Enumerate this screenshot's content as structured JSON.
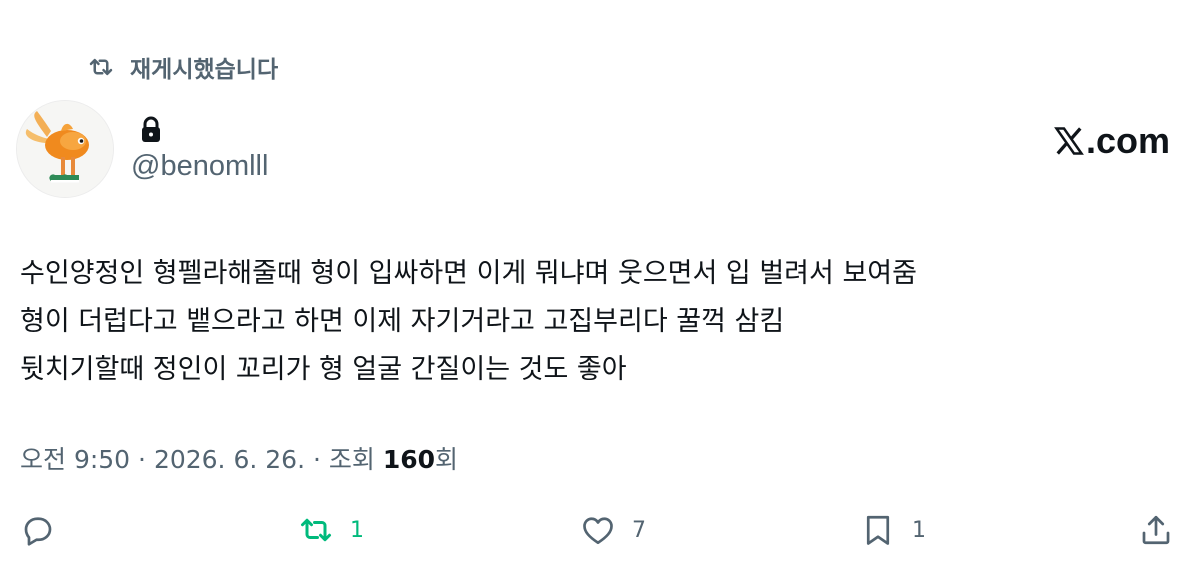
{
  "repost_banner": {
    "label": "재게시했습니다",
    "icon": "repost-icon"
  },
  "author": {
    "display_name_icon": "lock-icon",
    "handle": "@benomlll",
    "avatar": "goldfish-with-sneakers"
  },
  "brand": {
    "label": ".com",
    "icon": "x-logo-icon"
  },
  "tweet": {
    "lines": [
      "수인양정인 형펠라해줄때 형이 입싸하면 이게 뭐냐며 웃으면서 입 벌려서 보여줌",
      "형이 더럽다고 뱉으라고 하면 이제 자기거라고 고집부리다 꿀꺽 삼킴",
      "뒷치기할때 정인이 꼬리가 형 얼굴 간질이는 것도 좋아"
    ]
  },
  "meta": {
    "time": "오전 9:50",
    "separator": " · ",
    "date": "2026. 6. 26.",
    "views_prefix": "조회 ",
    "views_count": "160",
    "views_suffix": "회"
  },
  "actions": {
    "reply": {
      "icon": "reply-icon"
    },
    "repost": {
      "icon": "repost-icon",
      "count": "1",
      "color": "#00ba7c"
    },
    "like": {
      "icon": "heart-icon",
      "count": "7"
    },
    "bookmark": {
      "icon": "bookmark-icon",
      "count": "1"
    },
    "share": {
      "icon": "share-icon"
    }
  }
}
